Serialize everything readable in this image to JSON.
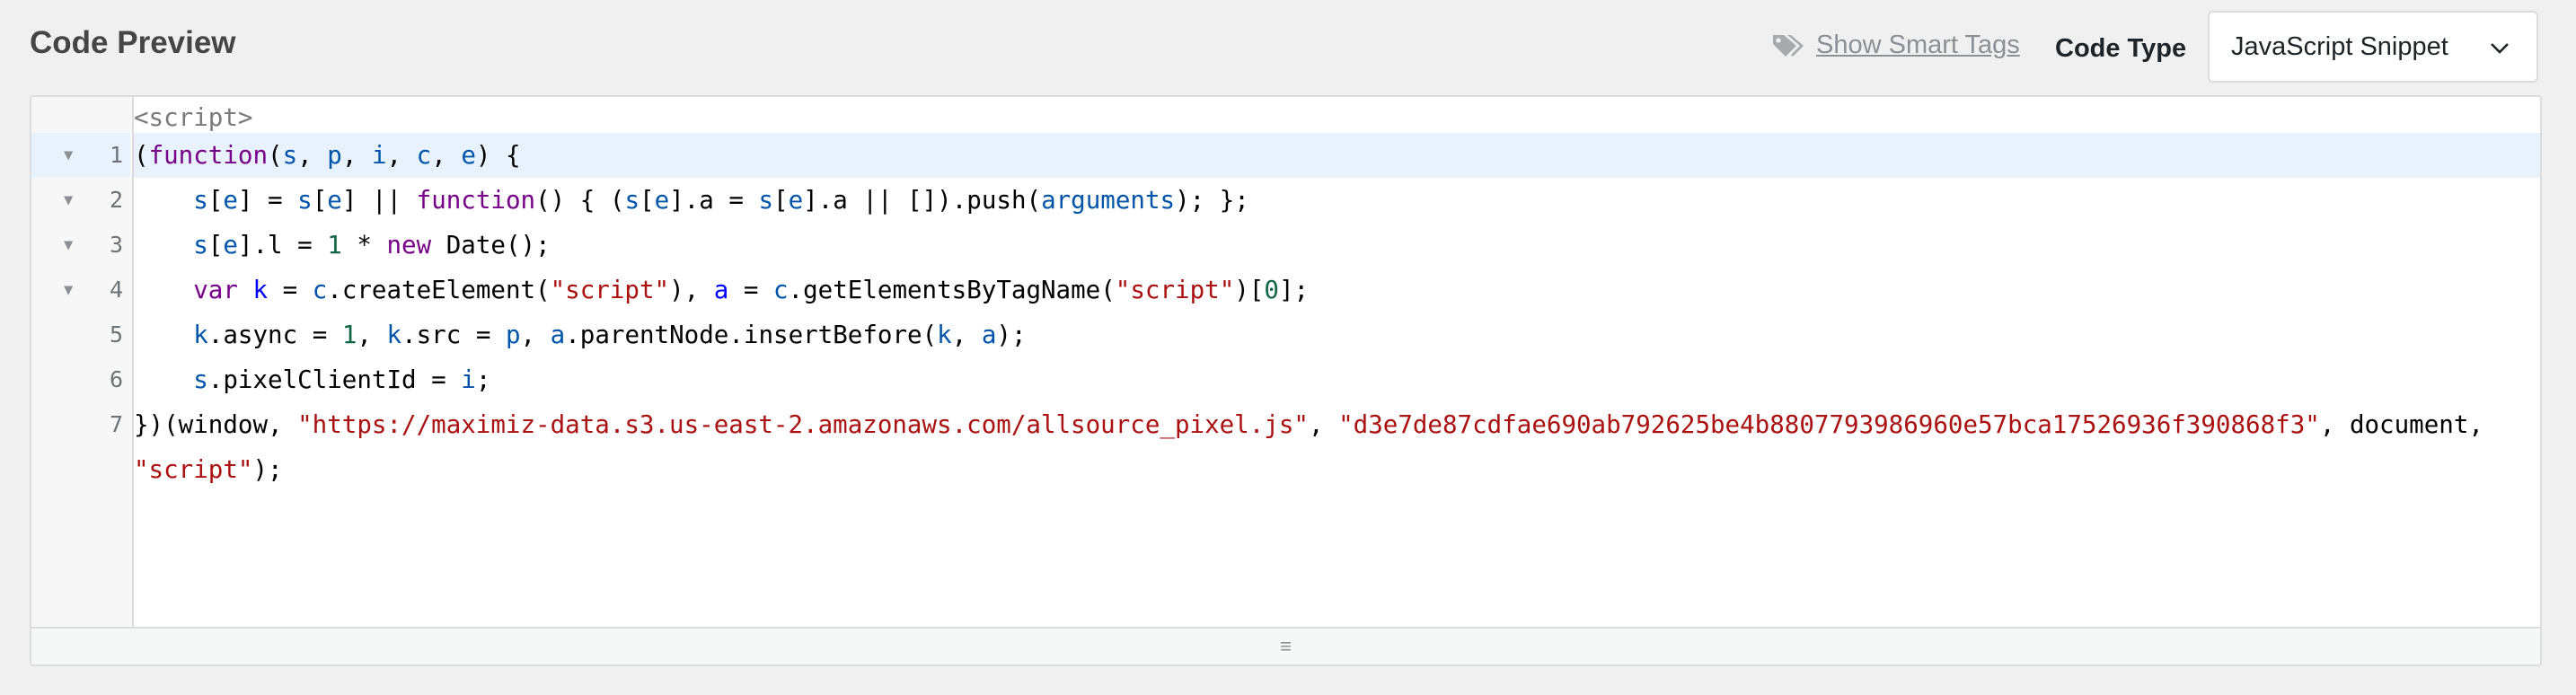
{
  "header": {
    "title": "Code Preview",
    "smart_tags_label": "Show Smart Tags",
    "code_type_label": "Code Type",
    "code_type_selected": "JavaScript Snippet"
  },
  "editor": {
    "pre_tag": "<script>",
    "lines": [
      {
        "num": "1",
        "fold": "▼",
        "tokens": [
          [
            "p",
            "("
          ],
          [
            "kw",
            "function"
          ],
          [
            "p",
            "("
          ],
          [
            "var",
            "s"
          ],
          [
            "p",
            ", "
          ],
          [
            "var",
            "p"
          ],
          [
            "p",
            ", "
          ],
          [
            "var",
            "i"
          ],
          [
            "p",
            ", "
          ],
          [
            "var",
            "c"
          ],
          [
            "p",
            ", "
          ],
          [
            "var",
            "e"
          ],
          [
            "p",
            ") {"
          ]
        ]
      },
      {
        "num": "2",
        "fold": "▼",
        "tokens": [
          [
            "p",
            "    "
          ],
          [
            "var",
            "s"
          ],
          [
            "p",
            "["
          ],
          [
            "var",
            "e"
          ],
          [
            "p",
            "] = "
          ],
          [
            "var",
            "s"
          ],
          [
            "p",
            "["
          ],
          [
            "var",
            "e"
          ],
          [
            "p",
            "] || "
          ],
          [
            "kw",
            "function"
          ],
          [
            "p",
            "() { ("
          ],
          [
            "var",
            "s"
          ],
          [
            "p",
            "["
          ],
          [
            "var",
            "e"
          ],
          [
            "p",
            "].a = "
          ],
          [
            "var",
            "s"
          ],
          [
            "p",
            "["
          ],
          [
            "var",
            "e"
          ],
          [
            "p",
            "].a || []).push("
          ],
          [
            "var",
            "arguments"
          ],
          [
            "p",
            "); };"
          ]
        ]
      },
      {
        "num": "3",
        "fold": "▼",
        "tokens": [
          [
            "p",
            "    "
          ],
          [
            "var",
            "s"
          ],
          [
            "p",
            "["
          ],
          [
            "var",
            "e"
          ],
          [
            "p",
            "].l = "
          ],
          [
            "num",
            "1"
          ],
          [
            "p",
            " * "
          ],
          [
            "kw",
            "new"
          ],
          [
            "p",
            " Date();"
          ]
        ]
      },
      {
        "num": "4",
        "fold": "▼",
        "tokens": [
          [
            "p",
            "    "
          ],
          [
            "kw",
            "var"
          ],
          [
            "p",
            " "
          ],
          [
            "def",
            "k"
          ],
          [
            "p",
            " = "
          ],
          [
            "var",
            "c"
          ],
          [
            "p",
            ".createElement("
          ],
          [
            "str",
            "\"script\""
          ],
          [
            "p",
            "), "
          ],
          [
            "def",
            "a"
          ],
          [
            "p",
            " = "
          ],
          [
            "var",
            "c"
          ],
          [
            "p",
            ".getElementsByTagName("
          ],
          [
            "str",
            "\"script\""
          ],
          [
            "p",
            ")["
          ],
          [
            "num",
            "0"
          ],
          [
            "p",
            "];"
          ]
        ]
      },
      {
        "num": "5",
        "fold": "",
        "tokens": [
          [
            "p",
            "    "
          ],
          [
            "var",
            "k"
          ],
          [
            "p",
            ".async = "
          ],
          [
            "num",
            "1"
          ],
          [
            "p",
            ", "
          ],
          [
            "var",
            "k"
          ],
          [
            "p",
            ".src = "
          ],
          [
            "var",
            "p"
          ],
          [
            "p",
            ", "
          ],
          [
            "var",
            "a"
          ],
          [
            "p",
            ".parentNode.insertBefore("
          ],
          [
            "var",
            "k"
          ],
          [
            "p",
            ", "
          ],
          [
            "var",
            "a"
          ],
          [
            "p",
            ");"
          ]
        ]
      },
      {
        "num": "6",
        "fold": "",
        "tokens": [
          [
            "p",
            "    "
          ],
          [
            "var",
            "s"
          ],
          [
            "p",
            ".pixelClientId = "
          ],
          [
            "var",
            "i"
          ],
          [
            "p",
            ";"
          ]
        ]
      },
      {
        "num": "7",
        "fold": "",
        "tokens": [
          [
            "p",
            "})(window, "
          ],
          [
            "str",
            "\"https://maximiz-data.s3.us-east-2.amazonaws.com/allsource_pixel.js\""
          ],
          [
            "p",
            ", "
          ],
          [
            "str",
            "\"d3e7de87cdfae690ab792625be4b8807793986960e57bca17526936f390868f3\""
          ],
          [
            "p",
            ", document,"
          ]
        ]
      },
      {
        "num": "",
        "fold": "",
        "tokens": [
          [
            "str",
            "\"script\""
          ],
          [
            "p",
            ");"
          ]
        ]
      }
    ],
    "resize_grip": "≡"
  },
  "icons": {
    "tag": "tag-icon",
    "chevron": "chevron-down-icon"
  },
  "colors": {
    "keyword": "#770088",
    "variable": "#0055aa",
    "definition": "#0000ff",
    "string": "#aa1111",
    "number": "#116644",
    "active_line": "#e8f2fc"
  }
}
